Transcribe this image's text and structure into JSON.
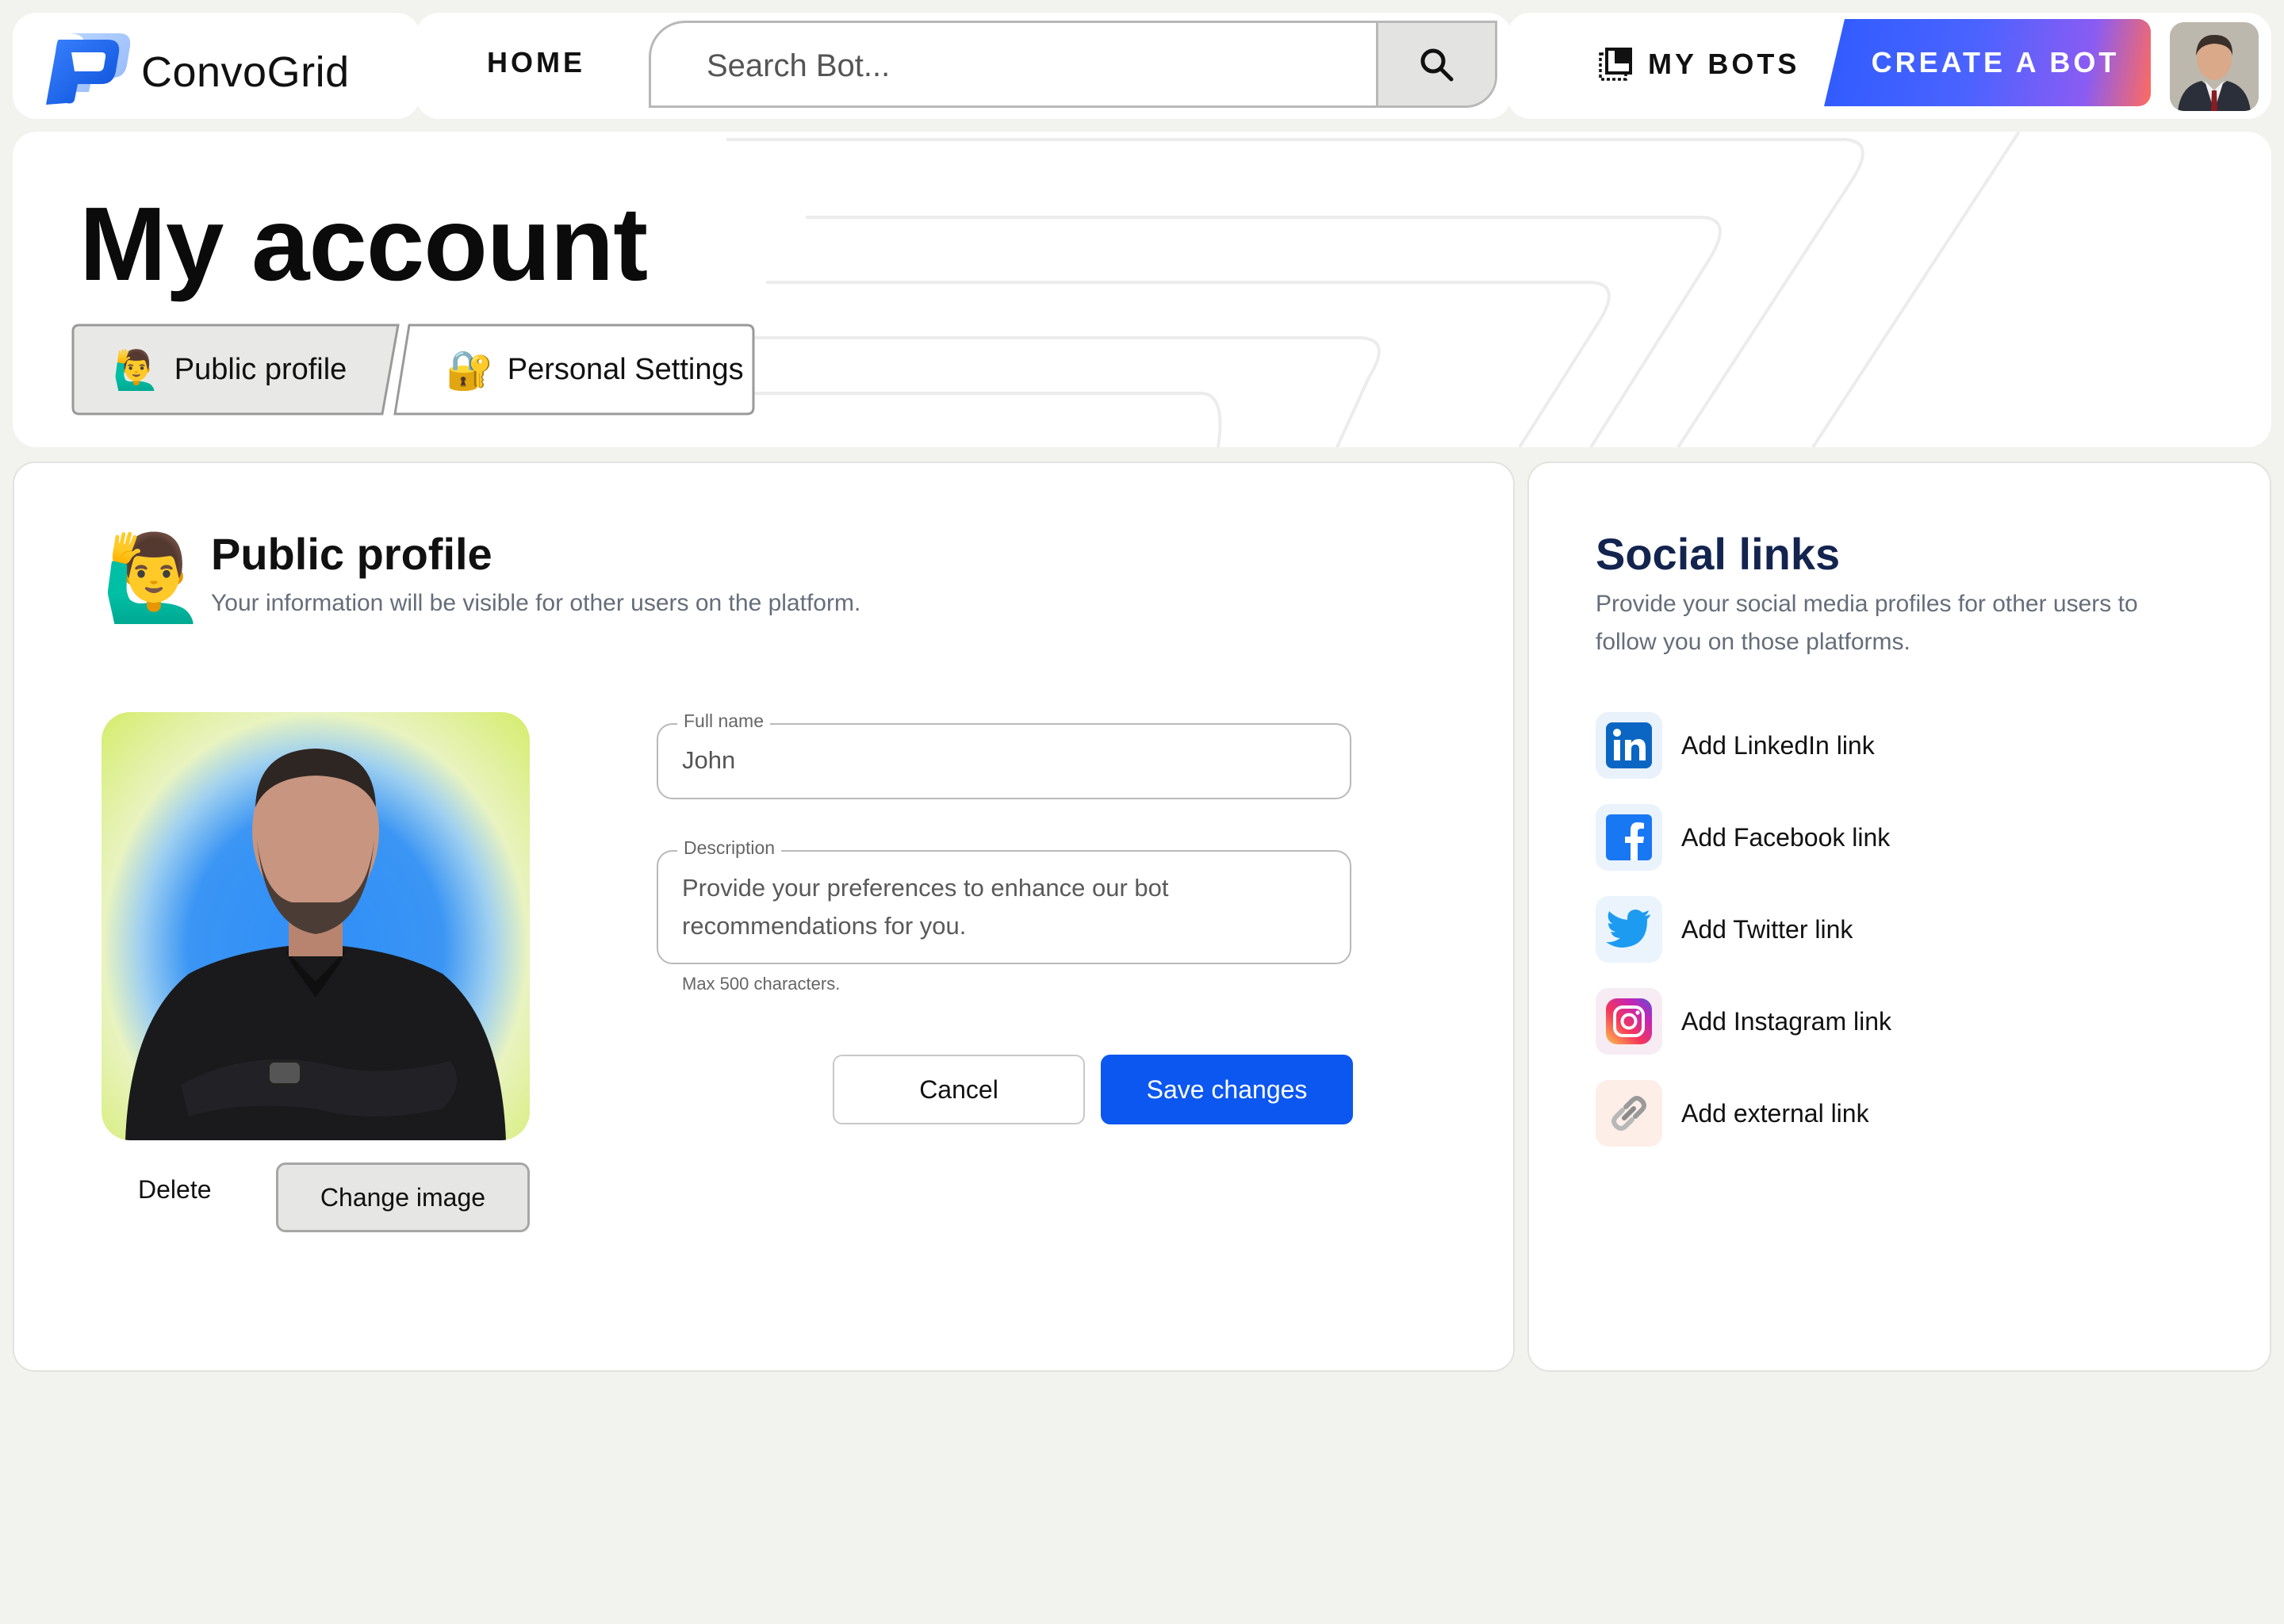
{
  "app": {
    "name": "ConvoGrid"
  },
  "nav": {
    "home": "HOME",
    "search_placeholder": "Search Bot...",
    "my_bots": "MY BOTS",
    "create_bot": "CREATE A BOT"
  },
  "page": {
    "title": "My account",
    "tabs": [
      {
        "emoji": "🙋‍♂️",
        "label": "Public profile",
        "active": true
      },
      {
        "emoji": "🔐",
        "label": "Personal Settings",
        "active": false
      }
    ]
  },
  "profile": {
    "emoji": "🙋‍♂️",
    "title": "Public profile",
    "subtitle": "Your information will be visible for other users on the platform.",
    "delete_label": "Delete",
    "change_image_label": "Change image",
    "full_name": {
      "label": "Full name",
      "value": "John"
    },
    "description": {
      "label": "Description",
      "placeholder": "Provide your preferences to enhance our bot recommendations for you.",
      "helper": "Max 500 characters."
    },
    "cancel_label": "Cancel",
    "save_label": "Save changes"
  },
  "social": {
    "title": "Social links",
    "subtitle": "Provide your social media profiles for other users to follow you on those platforms.",
    "links": [
      {
        "icon": "linkedin-icon",
        "label": "Add LinkedIn link"
      },
      {
        "icon": "facebook-icon",
        "label": "Add Facebook link"
      },
      {
        "icon": "twitter-icon",
        "label": "Add Twitter link"
      },
      {
        "icon": "instagram-icon",
        "label": "Add Instagram link"
      },
      {
        "icon": "link-icon",
        "label": "Add external link"
      }
    ]
  },
  "colors": {
    "background": "#f2f2ee",
    "primary": "#0b57f0",
    "social_title": "#13244f",
    "create_gradient": [
      "#2f5bff",
      "#8a5cf3",
      "#ff6b5e"
    ]
  }
}
